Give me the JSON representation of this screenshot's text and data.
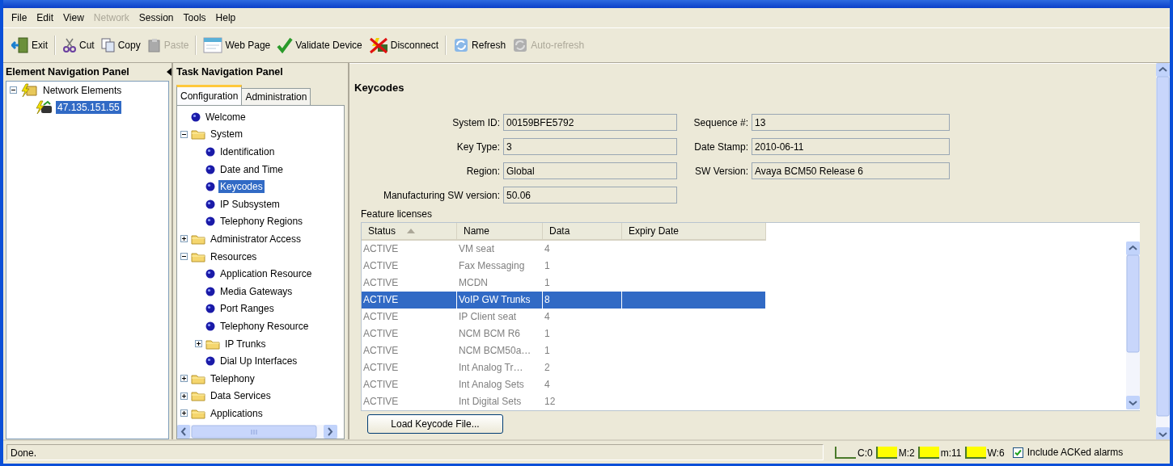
{
  "menu": [
    {
      "label": "File",
      "disabled": false
    },
    {
      "label": "Edit",
      "disabled": false
    },
    {
      "label": "View",
      "disabled": false
    },
    {
      "label": "Network",
      "disabled": true
    },
    {
      "label": "Session",
      "disabled": false
    },
    {
      "label": "Tools",
      "disabled": false
    },
    {
      "label": "Help",
      "disabled": false
    }
  ],
  "toolbar": [
    [
      {
        "label": "Exit",
        "disabled": false
      }
    ],
    [
      {
        "label": "Cut",
        "disabled": false
      },
      {
        "label": "Copy",
        "disabled": false
      },
      {
        "label": "Paste",
        "disabled": true
      }
    ],
    [
      {
        "label": "Web Page",
        "disabled": false
      },
      {
        "label": "Validate Device",
        "disabled": false
      },
      {
        "label": "Disconnect",
        "disabled": false
      }
    ],
    [
      {
        "label": "Refresh",
        "disabled": false
      },
      {
        "label": "Auto-refresh",
        "disabled": true
      }
    ]
  ],
  "element_panel": {
    "title": "Element Navigation Panel",
    "tree": [
      {
        "label": "Network Elements",
        "kind": "group",
        "expanded": true,
        "selected": false,
        "children": [
          {
            "label": "47.135.151.55",
            "kind": "device",
            "selected": true
          }
        ]
      }
    ]
  },
  "task_panel": {
    "title": "Task Navigation Panel",
    "tabs": [
      {
        "label": "Configuration",
        "selected": true
      },
      {
        "label": "Administration",
        "selected": false
      }
    ],
    "tree": [
      {
        "label": "Welcome",
        "kind": "leaf",
        "selected": false
      },
      {
        "label": "System",
        "kind": "folder",
        "expanded": true,
        "selected": false,
        "children": [
          {
            "label": "Identification",
            "kind": "leaf",
            "selected": false
          },
          {
            "label": "Date and Time",
            "kind": "leaf",
            "selected": false
          },
          {
            "label": "Keycodes",
            "kind": "leaf",
            "selected": true
          },
          {
            "label": "IP Subsystem",
            "kind": "leaf",
            "selected": false
          },
          {
            "label": "Telephony Regions",
            "kind": "leaf",
            "selected": false
          }
        ]
      },
      {
        "label": "Administrator Access",
        "kind": "folder",
        "expanded": false,
        "selected": false
      },
      {
        "label": "Resources",
        "kind": "folder",
        "expanded": true,
        "selected": false,
        "children": [
          {
            "label": "Application Resource",
            "kind": "leaf",
            "selected": false
          },
          {
            "label": "Media Gateways",
            "kind": "leaf",
            "selected": false
          },
          {
            "label": "Port Ranges",
            "kind": "leaf",
            "selected": false
          },
          {
            "label": "Telephony Resource",
            "kind": "leaf",
            "selected": false
          },
          {
            "label": "IP Trunks",
            "kind": "folder",
            "expanded": false,
            "selected": false
          },
          {
            "label": "Dial Up Interfaces",
            "kind": "leaf",
            "selected": false
          }
        ]
      },
      {
        "label": "Telephony",
        "kind": "folder",
        "expanded": false,
        "selected": false
      },
      {
        "label": "Data Services",
        "kind": "folder",
        "expanded": false,
        "selected": false
      },
      {
        "label": "Applications",
        "kind": "folder",
        "expanded": false,
        "selected": false
      }
    ]
  },
  "content": {
    "title": "Keycodes",
    "left_fields": [
      {
        "label": "System ID:",
        "value": "00159BFE5792"
      },
      {
        "label": "Key Type:",
        "value": "3"
      },
      {
        "label": "Region:",
        "value": "Global"
      },
      {
        "label": "Manufacturing SW version:",
        "value": "50.06"
      }
    ],
    "right_fields": [
      {
        "label": "Sequence #:",
        "value": "13"
      },
      {
        "label": "Date Stamp:",
        "value": "2010-06-11"
      },
      {
        "label": "SW Version:",
        "value": "Avaya BCM50 Release 6"
      }
    ],
    "table": {
      "title": "Feature licenses",
      "columns": [
        {
          "label": "Status",
          "sorted": true
        },
        {
          "label": "Name",
          "sorted": false
        },
        {
          "label": "Data",
          "sorted": false
        },
        {
          "label": "Expiry Date",
          "sorted": false
        }
      ],
      "rows": [
        {
          "cells": [
            "ACTIVE",
            "VM seat",
            "4"
          ],
          "selected": false
        },
        {
          "cells": [
            "ACTIVE",
            "Fax Messaging",
            "1"
          ],
          "selected": false
        },
        {
          "cells": [
            "ACTIVE",
            "MCDN",
            "1"
          ],
          "selected": false
        },
        {
          "cells": [
            "ACTIVE",
            "VoIP GW Trunks",
            "8"
          ],
          "selected": true
        },
        {
          "cells": [
            "ACTIVE",
            "IP Client seat",
            "4"
          ],
          "selected": false
        },
        {
          "cells": [
            "ACTIVE",
            "NCM BCM R6",
            "1"
          ],
          "selected": false
        },
        {
          "cells": [
            "ACTIVE",
            "NCM BCM50a…",
            "1"
          ],
          "selected": false
        },
        {
          "cells": [
            "ACTIVE",
            "Int Analog Tr…",
            "2"
          ],
          "selected": false
        },
        {
          "cells": [
            "ACTIVE",
            "Int Analog Sets",
            "4"
          ],
          "selected": false
        },
        {
          "cells": [
            "ACTIVE",
            "Int Digital Sets",
            "12"
          ],
          "selected": false
        }
      ]
    },
    "button": "Load Keycode File..."
  },
  "status_bar": {
    "message": "Done.",
    "alarms": [
      {
        "label": "C:0",
        "color": "#ece9d8"
      },
      {
        "label": "M:2",
        "color": "#ffff00"
      },
      {
        "label": "m:11",
        "color": "#ffff00"
      },
      {
        "label": "W:6",
        "color": "#ffff00"
      }
    ],
    "include_acked": {
      "label": "Include ACKed alarms",
      "checked": true
    }
  }
}
